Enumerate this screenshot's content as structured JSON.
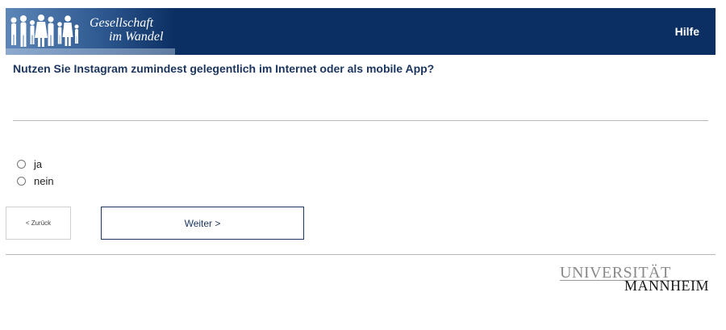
{
  "header": {
    "logo": {
      "line1": "Gesellschaft",
      "line2": "im Wandel",
      "icon": "silhouettes-icon"
    },
    "help_label": "Hilfe"
  },
  "question": {
    "text": "Nutzen Sie Instagram zumindest gelegentlich im Internet oder als mobile App?",
    "options": [
      {
        "label": "ja",
        "selected": false
      },
      {
        "label": "nein",
        "selected": false
      }
    ]
  },
  "navigation": {
    "back_label": "< Zurück",
    "next_label": "Weiter >"
  },
  "footer": {
    "university_line1": "UNIVERSITÄT",
    "university_line2": "MANNHEIM"
  },
  "colors": {
    "header_bg": "#0b2f63",
    "question_text": "#1c3660",
    "next_button_border": "#1c3660"
  }
}
